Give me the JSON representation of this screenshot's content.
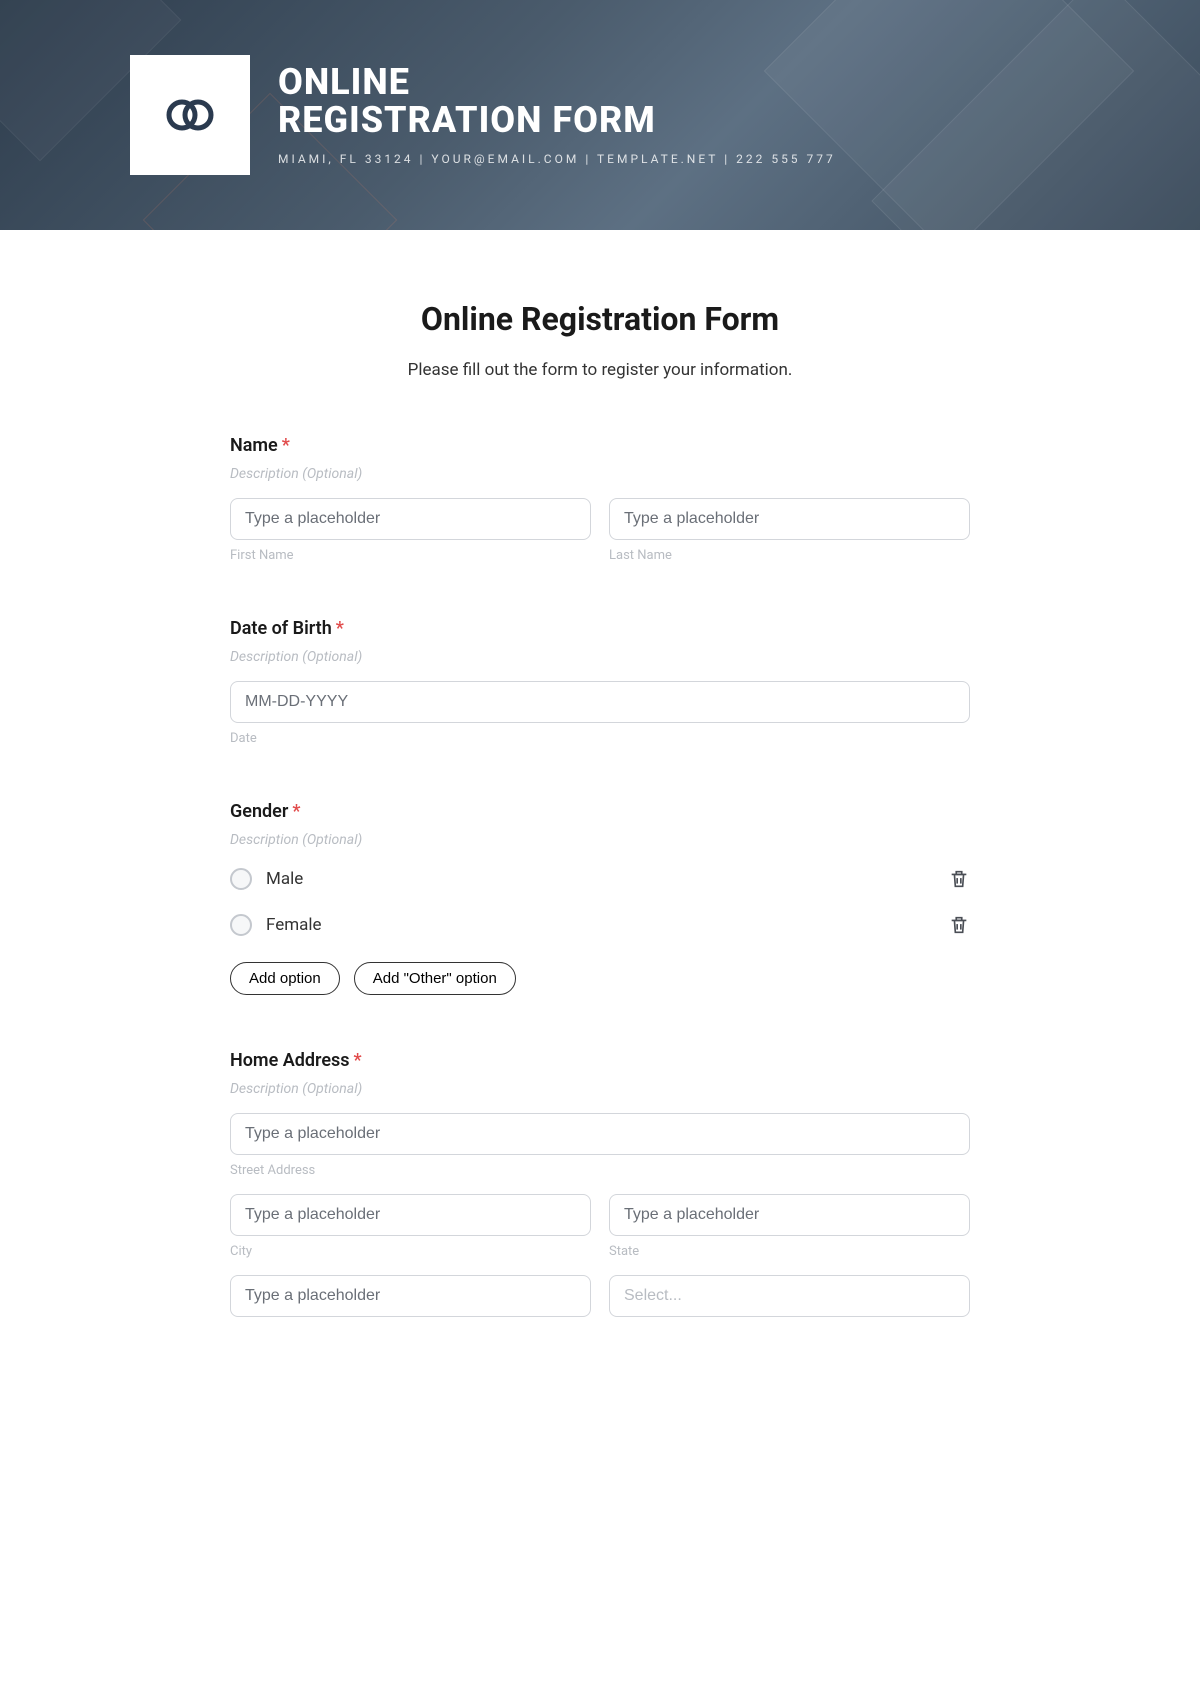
{
  "hero": {
    "title_line1": "ONLINE",
    "title_line2": "REGISTRATION FORM",
    "subline": "MIAMI, FL 33124 | YOUR@EMAIL.COM | TEMPLATE.NET | 222 555 777"
  },
  "page": {
    "title": "Online Registration Form",
    "description": "Please fill out the form to register your information."
  },
  "common": {
    "required_mark": "*",
    "desc_placeholder": "Description (Optional)",
    "text_placeholder": "Type a placeholder"
  },
  "fields": {
    "name": {
      "label": "Name",
      "first_sub": "First Name",
      "last_sub": "Last Name"
    },
    "dob": {
      "label": "Date of Birth",
      "placeholder": "MM-DD-YYYY",
      "sub": "Date"
    },
    "gender": {
      "label": "Gender",
      "options": [
        "Male",
        "Female"
      ],
      "add_option": "Add option",
      "add_other": "Add \"Other\" option"
    },
    "home": {
      "label": "Home Address",
      "street_sub": "Street Address",
      "city_sub": "City",
      "state_sub": "State",
      "select_placeholder": "Select..."
    }
  }
}
